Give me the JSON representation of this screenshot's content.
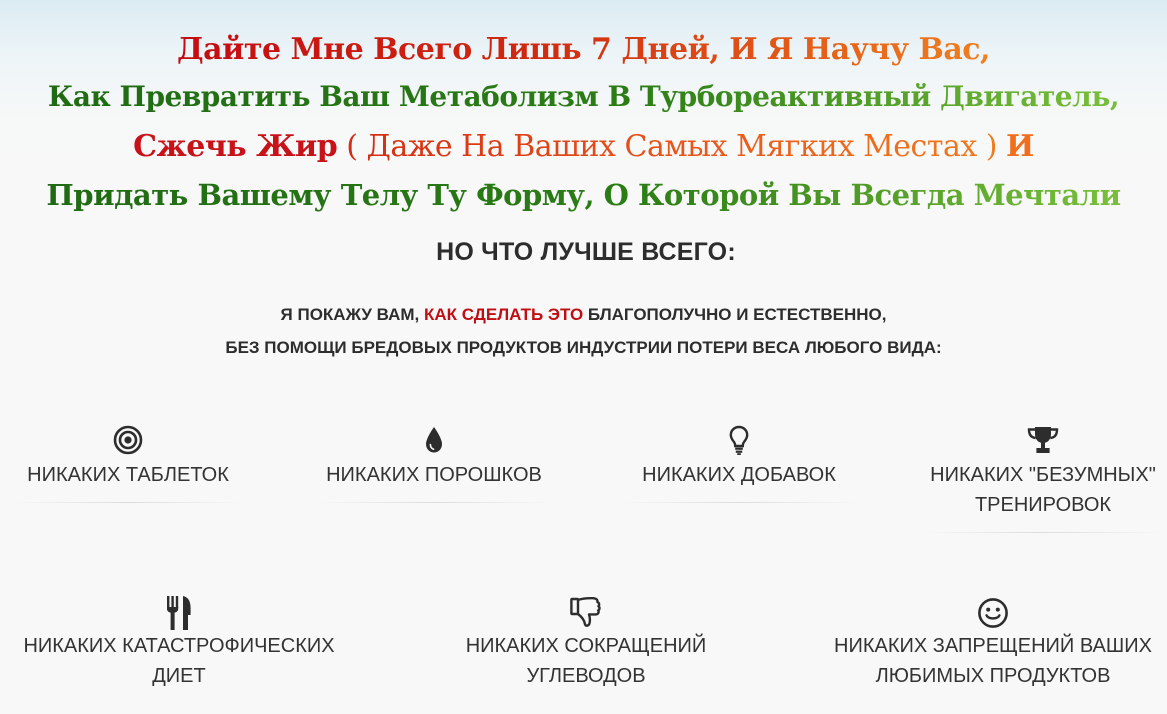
{
  "headline": {
    "line1": "Дайте Мне Всего Лишь 7 Дней, И Я Научу Вас,",
    "line2": "Как Превратить Ваш Метаболизм В Турбореактивный Двигатель,",
    "line3_strong": "Сжечь Жир",
    "line3_paren": " ( Даже На Ваших Самых Мягких Местах ) ",
    "line3_and": "И",
    "line4": "Придать Вашему Телу Ту Форму, О Которой Вы Всегда Мечтали"
  },
  "subhead": "НО ЧТО ЛУЧШЕ ВСЕГО:",
  "intro": {
    "line1_a": "Я ПОКАЖУ ВАМ, ",
    "line1_accent": "КАК СДЕЛАТЬ ЭТО",
    "line1_b": " БЛАГОПОЛУЧНО И ЕСТЕСТВЕННО,",
    "line2": "БЕЗ ПОМОЩИ БРЕДОВЫХ ПРОДУКТОВ ИНДУСТРИИ ПОТЕРИ ВЕСА ЛЮБОГО ВИДА:"
  },
  "features": [
    {
      "icon": "target-icon",
      "label": "НИКАКИХ ТАБЛЕТОК"
    },
    {
      "icon": "drop-icon",
      "label": "НИКАКИХ ПОРОШКОВ"
    },
    {
      "icon": "lightbulb-icon",
      "label": "НИКАКИХ ДОБАВОК"
    },
    {
      "icon": "trophy-icon",
      "label": "НИКАКИХ \"БЕЗУМНЫХ\"\nТРЕНИРОВОК"
    },
    {
      "icon": "cutlery-icon",
      "label": "НИКАКИХ КАТАСТРОФИЧЕСКИХ\nДИЕТ"
    },
    {
      "icon": "thumbs-down-icon",
      "label": "НИКАКИХ СОКРАЩЕНИЙ\nУГЛЕВОДОВ"
    },
    {
      "icon": "smile-icon",
      "label": "НИКАКИХ ЗАПРЕЩЕНИЙ ВАШИХ\nЛЮБИМЫХ ПРОДУКТОВ"
    }
  ],
  "colors": {
    "headline_red": "#c40b12",
    "headline_orange": "#f0801f",
    "headline_green": "#2c7d16",
    "text_dark": "#2d2d2d",
    "accent_red": "#c00f14"
  }
}
